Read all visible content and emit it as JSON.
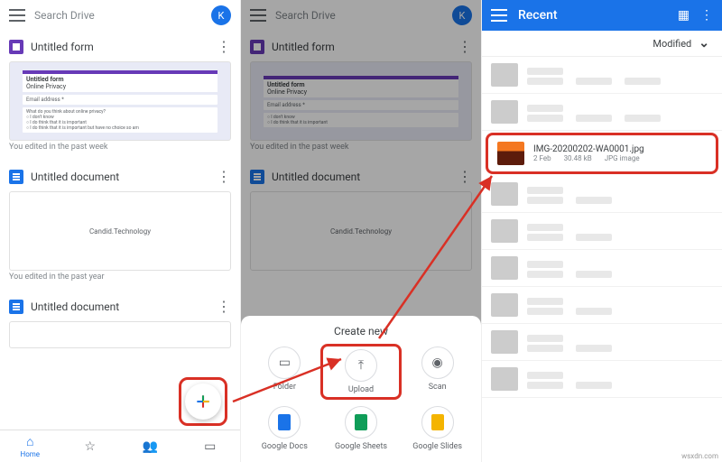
{
  "panel1": {
    "search_placeholder": "Search Drive",
    "avatar_letter": "K",
    "items": [
      {
        "title": "Untitled form",
        "sub": "You edited in the past week",
        "type": "form",
        "form": {
          "header_title": "Untitled form",
          "header_sub": "Online Privacy",
          "q1": "Email address *",
          "q2": "What do you think about online privacy?",
          "opt1": "I don't know",
          "opt2": "I do think that it is important",
          "opt3": "I do think that it is important but have no choice so am"
        }
      },
      {
        "title": "Untitled document",
        "sub": "You edited in the past year",
        "type": "doc",
        "doc_text": "Candid.Technology"
      },
      {
        "title": "Untitled document",
        "sub": "",
        "type": "doc",
        "doc_text": ""
      }
    ],
    "nav": {
      "home": "Home"
    }
  },
  "panel2": {
    "search_placeholder": "Search Drive",
    "avatar_letter": "K",
    "items": [
      {
        "title": "Untitled form",
        "sub": "You edited in the past week"
      },
      {
        "title": "Untitled document"
      }
    ],
    "sheet_title": "Create new",
    "actions": [
      "Folder",
      "Upload",
      "Scan",
      "Google Docs",
      "Google Sheets",
      "Google Slides"
    ]
  },
  "panel3": {
    "title": "Recent",
    "sort_label": "Modified",
    "highlight": {
      "name": "IMG-20200202-WA0001.jpg",
      "date": "2 Feb",
      "size": "30.48 kB",
      "type": "JPG image"
    }
  },
  "watermark": "wsxdn.com"
}
